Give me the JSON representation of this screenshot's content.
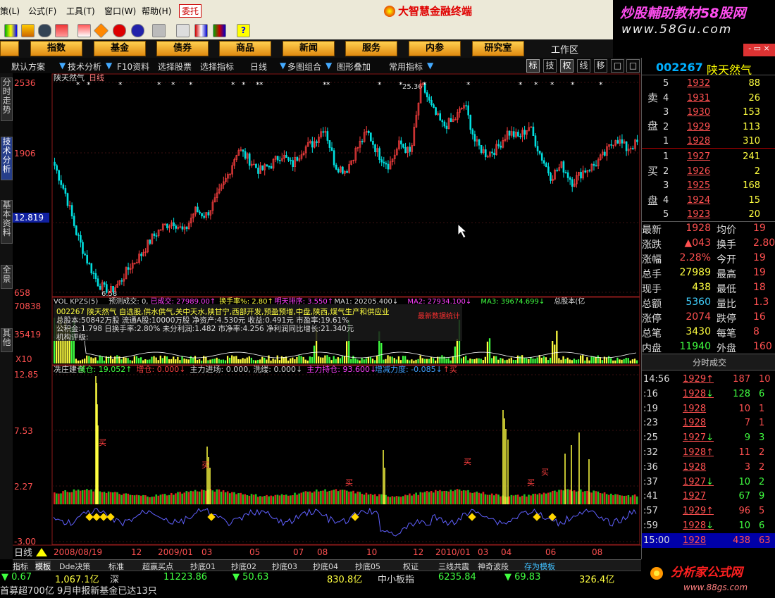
{
  "menu": {
    "items": [
      "策(L)",
      "公式(F)",
      "工具(T)",
      "窗口(W)",
      "帮助(H)"
    ],
    "hot": "委托",
    "app_title": "大智慧金融终端"
  },
  "brand": {
    "line1": "炒股輔助教材58股网",
    "line2": "www.58Gu.com"
  },
  "nav": {
    "buttons": [
      "指数",
      "基金",
      "债券",
      "商品",
      "新闻",
      "服务",
      "内参",
      "研究室"
    ],
    "workarea": "工作区",
    "window_ctrl": "- ▭ ×"
  },
  "subbar": {
    "items": [
      "默认方案",
      "▼",
      "技术分析",
      "▼",
      "F10资料",
      "选择股票",
      "选择指标",
      "日线",
      "▼",
      "多图组合",
      "▼",
      "图形叠加",
      "常用指标",
      "▼"
    ],
    "right_buttons": [
      "标",
      "技",
      "权",
      "线",
      "移",
      "□",
      "□",
      "▶"
    ]
  },
  "left_tabs": [
    "分时走势",
    "技术分析",
    "基本资料",
    "全景",
    "其他"
  ],
  "chart": {
    "title": "陕天然气",
    "period": "日线",
    "y_labels": [
      "2536",
      "1906",
      "12.819",
      "658"
    ],
    "high_label": "25.36",
    "low_label": "6.58",
    "vol": {
      "header": [
        {
          "t": "VOL KPZS(5)",
          "c": "#dddddd"
        },
        {
          "t": "预测成交: 0,",
          "c": "#dddddd"
        },
        {
          "t": "已成交: 27989.00↑",
          "c": "#ff40ff"
        },
        {
          "t": "换手率%: 2.80↑",
          "c": "#ffff40"
        },
        {
          "t": "明天排序: 3.550↑",
          "c": "#ff40ff"
        },
        {
          "t": "MA1: 20205.400↓",
          "c": "#dddddd"
        },
        {
          "t": "MA2: 27934.100↓",
          "c": "#ff40ff"
        },
        {
          "t": "MA3: 39674.699↓",
          "c": "#40ff40"
        },
        {
          "t": "总股本(亿",
          "c": "#dddddd"
        }
      ],
      "y_labels": [
        "70838",
        "35419",
        "X10"
      ],
      "info": [
        {
          "t": "002267 陕天然气  自选股,供水供气,关中天水,陕甘宁,西部开发,预盈预增,中盘,陕西,煤气生产和供应业",
          "c": "#ffff40"
        },
        {
          "t": "总股本:50842万股  流通A股:10000万股   净资产:4.530元   收益:0.491元   市盈率:19.61%",
          "c": "#dddddd"
        },
        {
          "t": "公积金:1.798   日换手率:2.80%   未分利润:1.482   市净率:4.256   净利润同比增长:21.340元",
          "c": "#dddddd"
        },
        {
          "t": "机构评级:",
          "c": "#dddddd"
        }
      ],
      "red_note": "最新数据统计"
    },
    "kz": {
      "header": [
        {
          "t": "冼庄建仓",
          "c": "#dddddd"
        },
        {
          "t": "减仓: 19.052↑",
          "c": "#40ff40"
        },
        {
          "t": "增仓: 0.000↓",
          "c": "#ff4040"
        },
        {
          "t": "主力进场: 0.000,",
          "c": "#dddddd"
        },
        {
          "t": "洗缕: 0.000↓",
          "c": "#dddddd"
        },
        {
          "t": "主力持仓: 93.600↓",
          "c": "#ff40ff"
        },
        {
          "t": "增减力度: -0.085↓",
          "c": "#40a0ff"
        },
        {
          "t": "↑买",
          "c": "#ff4040"
        }
      ],
      "y_labels": [
        "12.85",
        "7.53",
        "2.27",
        "-3.00"
      ],
      "buy_label": "买"
    },
    "x_labels": [
      "2008/08/19",
      "12",
      "2009/01",
      "03",
      "05",
      "07",
      "08",
      "10",
      "12",
      "2010/01",
      "03",
      "04",
      "06",
      "08"
    ],
    "period_btn": "日线"
  },
  "chart_data": {
    "type": "candlestick",
    "title": "陕天然气",
    "x_range": [
      "2008/08",
      "2010/09"
    ],
    "ylim": [
      6.58,
      25.36
    ],
    "price_path": [
      18.0,
      15.5,
      12.0,
      9.5,
      7.5,
      6.58,
      7.5,
      9.0,
      10.0,
      11.5,
      12.5,
      13.0,
      12.0,
      14.0,
      13.5,
      15.0,
      17.0,
      19.5,
      18.5,
      17.5,
      18.0,
      19.0,
      18.0,
      19.5,
      20.0,
      21.5,
      18.0,
      17.5,
      19.5,
      21.0,
      19.0,
      18.0,
      20.0,
      19.0,
      25.36,
      23.0,
      21.5,
      22.0,
      23.5,
      20.0,
      19.0,
      19.5,
      21.0,
      20.5,
      21.5,
      19.0,
      17.0,
      18.0,
      16.5,
      17.5,
      18.0,
      19.0,
      20.5,
      19.5,
      20.0
    ],
    "volume_ylim": [
      0,
      70838
    ],
    "kz_ylim": [
      -3.0,
      12.85
    ]
  },
  "right": {
    "code": "002267",
    "name": "陕天然气",
    "sell": [
      {
        "n": "5",
        "p": "1932",
        "v": "88"
      },
      {
        "n": "4",
        "p": "1931",
        "v": "26"
      },
      {
        "n": "3",
        "p": "1930",
        "v": "153"
      },
      {
        "n": "2",
        "p": "1929",
        "v": "113"
      },
      {
        "n": "1",
        "p": "1928",
        "v": "310"
      }
    ],
    "buy": [
      {
        "n": "1",
        "p": "1927",
        "v": "241"
      },
      {
        "n": "2",
        "p": "1926",
        "v": "2"
      },
      {
        "n": "3",
        "p": "1925",
        "v": "168"
      },
      {
        "n": "4",
        "p": "1924",
        "v": "15"
      },
      {
        "n": "5",
        "p": "1923",
        "v": "20"
      }
    ],
    "sell_label": [
      "卖",
      "盘"
    ],
    "buy_label": [
      "买",
      "盘"
    ],
    "stats": [
      {
        "l": "最新",
        "v": "1928",
        "vc": "#ff5050",
        "l2": "均价",
        "v2": "19"
      },
      {
        "l": "涨跌",
        "v": "▲043",
        "vc": "#ff5050",
        "l2": "换手",
        "v2": "2.80"
      },
      {
        "l": "涨幅",
        "v": "2.28%",
        "vc": "#ff5050",
        "l2": "今开",
        "v2": "19"
      },
      {
        "l": "总手",
        "v": "27989",
        "vc": "#ffff40",
        "l2": "最高",
        "v2": "19"
      },
      {
        "l": "现手",
        "v": "438",
        "vc": "#ffff40",
        "l2": "最低",
        "v2": "18"
      },
      {
        "l": "总额",
        "v": "5360",
        "vc": "#40d0ff",
        "l2": "量比",
        "v2": "1.3"
      },
      {
        "l": "涨停",
        "v": "2074",
        "vc": "#ff5050",
        "l2": "跌停",
        "v2": "16"
      },
      {
        "l": "总笔",
        "v": "3430",
        "vc": "#ffff40",
        "l2": "每笔",
        "v2": "8"
      },
      {
        "l": "内盘",
        "v": "11940",
        "vc": "#40ff40",
        "l2": "外盘",
        "v2": "160"
      }
    ],
    "trades_header": "分时成交",
    "trades": [
      {
        "t": "14:56",
        "p": "1929",
        "a": "↑",
        "v": "187",
        "vc": "#ff5050",
        "x": "10"
      },
      {
        "t": ":16",
        "p": "1928",
        "a": "↓",
        "v": "128",
        "vc": "#40ff40",
        "x": "6"
      },
      {
        "t": ":19",
        "p": "1928",
        "a": "",
        "v": "10",
        "vc": "#ff5050",
        "x": "1"
      },
      {
        "t": ":23",
        "p": "1928",
        "a": "",
        "v": "7",
        "vc": "#ff5050",
        "x": "1"
      },
      {
        "t": ":25",
        "p": "1927",
        "a": "↓",
        "v": "9",
        "vc": "#40ff40",
        "x": "3"
      },
      {
        "t": ":32",
        "p": "1928",
        "a": "↑",
        "v": "11",
        "vc": "#ff5050",
        "x": "2"
      },
      {
        "t": ":36",
        "p": "1928",
        "a": "",
        "v": "3",
        "vc": "#ff5050",
        "x": "2"
      },
      {
        "t": ":37",
        "p": "1927",
        "a": "↓",
        "v": "10",
        "vc": "#40ff40",
        "x": "2"
      },
      {
        "t": ":41",
        "p": "1927",
        "a": "",
        "v": "67",
        "vc": "#40ff40",
        "x": "9"
      },
      {
        "t": ":57",
        "p": "1929",
        "a": "↑",
        "v": "96",
        "vc": "#ff5050",
        "x": "5"
      },
      {
        "t": ":59",
        "p": "1928",
        "a": "↓",
        "v": "10",
        "vc": "#40ff40",
        "x": "6"
      },
      {
        "t": "15:00",
        "p": "1928",
        "a": "",
        "v": "438",
        "vc": "#ff5050",
        "x": "63"
      }
    ]
  },
  "bottom_tabs": [
    "指标",
    "模板",
    "Dde决策",
    "标准",
    "超赢买点",
    "抄底01",
    "抄底02",
    "抄底03",
    "抄底04",
    "抄底05",
    "权证",
    "三线共震",
    "神奇波段",
    "存为模板"
  ],
  "ticker": [
    {
      "t": "▼ 0.67",
      "c": "#40ff40"
    },
    {
      "t": "1,067.1亿",
      "c": "#ffff40"
    },
    {
      "t": "深",
      "c": "#dddddd"
    },
    {
      "t": "11223.86",
      "c": "#40ff40"
    },
    {
      "t": "▼ 50.63",
      "c": "#40ff40"
    },
    {
      "t": "830.8亿",
      "c": "#ffff40"
    },
    {
      "t": "中小板指",
      "c": "#dddddd"
    },
    {
      "t": "6235.84",
      "c": "#40ff40"
    },
    {
      "t": "▼ 69.83",
      "c": "#40ff40"
    },
    {
      "t": "326.4亿",
      "c": "#ffff40"
    }
  ],
  "news": "首募超700亿 9月申报新基金已达13只",
  "fxj": {
    "l1": "分析家公式网",
    "l2": "www.88gs.com"
  }
}
